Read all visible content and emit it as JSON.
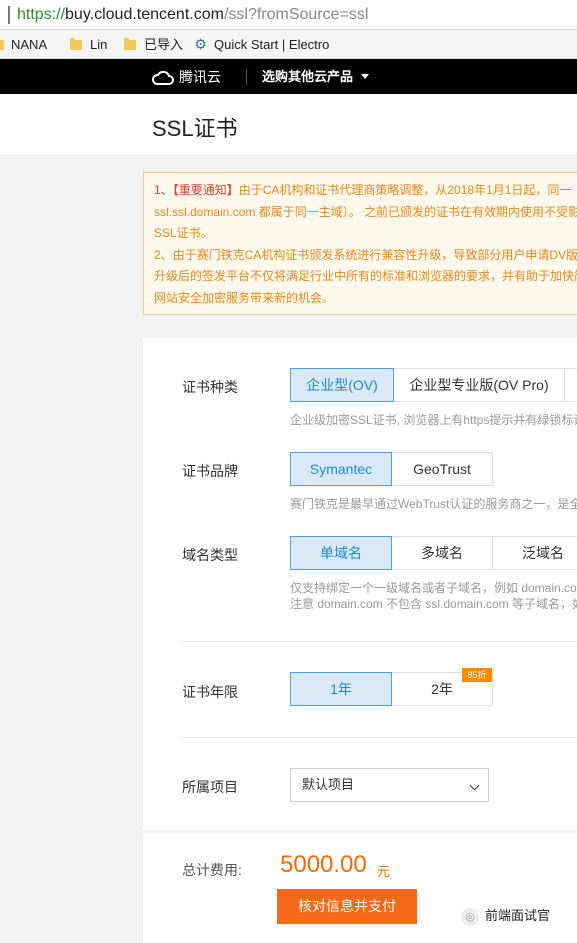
{
  "browser": {
    "url_scheme": "https://",
    "url_host": "buy.cloud.tencent.com",
    "url_path": "/ssl?fromSource=ssl",
    "bookmarks": [
      {
        "label": "NANA",
        "icon": "folder-icon"
      },
      {
        "label": "Lin",
        "icon": "folder-icon"
      },
      {
        "label": "已导入",
        "icon": "folder-icon"
      },
      {
        "label": "Quick Start | Electro",
        "icon": "gear-icon"
      }
    ]
  },
  "nav": {
    "brand": "腾讯云",
    "products": "选购其他云产品"
  },
  "page": {
    "title": "SSL证书"
  },
  "notice": {
    "line1_prefix": "1、",
    "line1_highlight": "【重要通知】",
    "line1_rest": "由于CA机构和证书代理商策略调整，从2018年1月1日起，同一",
    "line2": "ssl.ssl.domain.com 都属于同一主域）。 之前已颁发的证书在有效期内使用不受影",
    "line3": "SSL证书。",
    "line4": "2、由于赛门铁克CA机构证书颁发系统进行兼容性升级，导致部分用户申请DV版",
    "line5": "升级后的签发平台不仅将满足行业中所有的标准和浏览器的要求，并有助于加快简",
    "line6": "网站安全加密服务带来新的机会。"
  },
  "form": {
    "cert_type": {
      "label": "证书种类",
      "options": [
        "企业型(OV)",
        "企业型专业版(OV Pro)"
      ],
      "hint": "企业级加密SSL证书, 浏览器上有https提示并有绿锁标识"
    },
    "cert_brand": {
      "label": "证书品牌",
      "options": [
        "Symantec",
        "GeoTrust"
      ],
      "hint": "赛门铁克是最早通过WebTrust认证的服务商之一，是全"
    },
    "domain_type": {
      "label": "域名类型",
      "options": [
        "单域名",
        "多域名",
        "泛域名"
      ],
      "hint1": "仅支持绑定一个一级域名或者子域名，例如 domain.co",
      "hint2": "注意 domain.com 不包含 ssl.domain.com 等子域名，如"
    },
    "cert_years": {
      "label": "证书年限",
      "options": [
        "1年",
        "2年"
      ],
      "discount": "85折"
    },
    "project": {
      "label": "所属项目",
      "value": "默认项目"
    }
  },
  "footer": {
    "total_label": "总计费用:",
    "price": "5000.00",
    "unit": "元",
    "pay_button": "核对信息并支付"
  },
  "watermark": {
    "text": "前端面试官"
  },
  "colors": {
    "accent": "#1b8bd8",
    "selected_bg": "#d9e9f8",
    "orange": "#f5691b",
    "notice_red": "#e33c2f"
  }
}
